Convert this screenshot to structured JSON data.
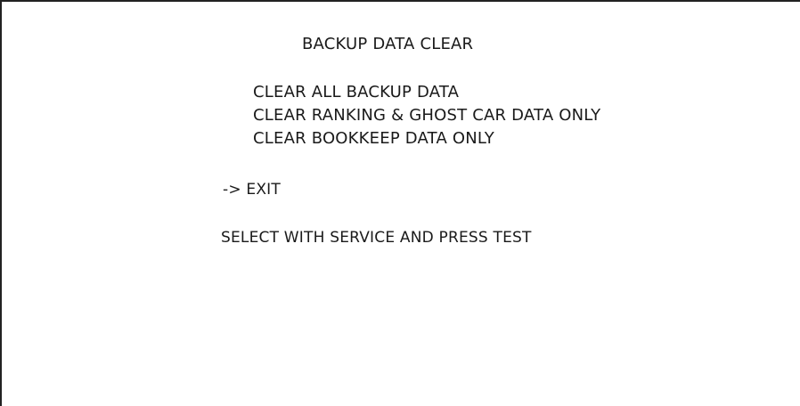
{
  "screen": {
    "title": "BACKUP DATA CLEAR",
    "menu_items": [
      "CLEAR ALL BACKUP DATA",
      "CLEAR RANKING & GHOST CAR DATA ONLY",
      "CLEAR BOOKKEEP DATA ONLY"
    ],
    "cursor": "->",
    "exit_label": "EXIT",
    "instruction": "SELECT WITH SERVICE AND PRESS TEST"
  }
}
